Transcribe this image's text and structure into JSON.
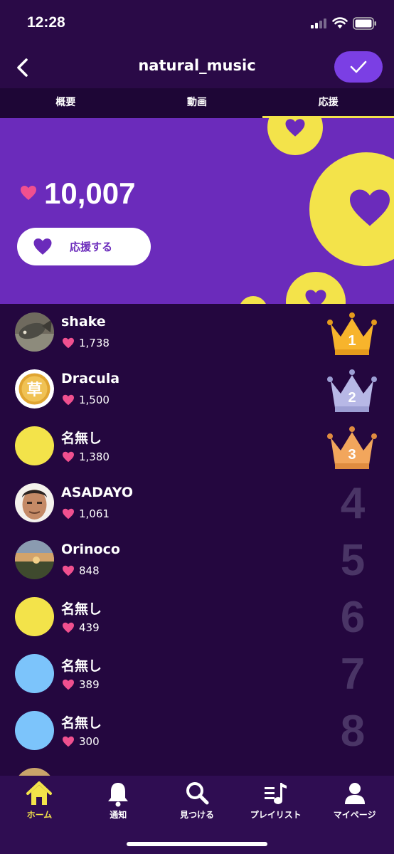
{
  "status": {
    "time": "12:28"
  },
  "header": {
    "title": "natural_music"
  },
  "tabs": [
    {
      "label": "概要"
    },
    {
      "label": "動画"
    },
    {
      "label": "応援",
      "active": true
    }
  ],
  "support": {
    "total": "10,007",
    "button_label": "応援する"
  },
  "ranking": [
    {
      "rank": "1",
      "name": "shake",
      "count": "1,738",
      "avatar": "photo-fish",
      "crown": "gold"
    },
    {
      "rank": "2",
      "name": "Dracula",
      "count": "1,500",
      "avatar": "coin-kusa",
      "crown": "silver"
    },
    {
      "rank": "3",
      "name": "名無し",
      "count": "1,380",
      "avatar": "yellow",
      "crown": "bronze"
    },
    {
      "rank": "4",
      "name": "ASADAYO",
      "count": "1,061",
      "avatar": "photo-face"
    },
    {
      "rank": "5",
      "name": "Orinoco",
      "count": "848",
      "avatar": "photo-sunset"
    },
    {
      "rank": "6",
      "name": "名無し",
      "count": "439",
      "avatar": "yellow"
    },
    {
      "rank": "7",
      "name": "名無し",
      "count": "389",
      "avatar": "blue"
    },
    {
      "rank": "8",
      "name": "名無し",
      "count": "300",
      "avatar": "blue"
    }
  ],
  "avatar_glyphs": {
    "coin": "草"
  },
  "bottom_nav": [
    {
      "label": "ホーム",
      "icon": "home-icon",
      "active": true
    },
    {
      "label": "通知",
      "icon": "bell-icon"
    },
    {
      "label": "見つける",
      "icon": "search-icon"
    },
    {
      "label": "プレイリスト",
      "icon": "playlist-icon"
    },
    {
      "label": "マイページ",
      "icon": "person-icon"
    }
  ],
  "colors": {
    "background": "#24073f",
    "hero": "#6b2bbb",
    "accent_yellow": "#f3e34a",
    "heart_pink": "#f0508f",
    "check_button": "#7b3fe4"
  }
}
